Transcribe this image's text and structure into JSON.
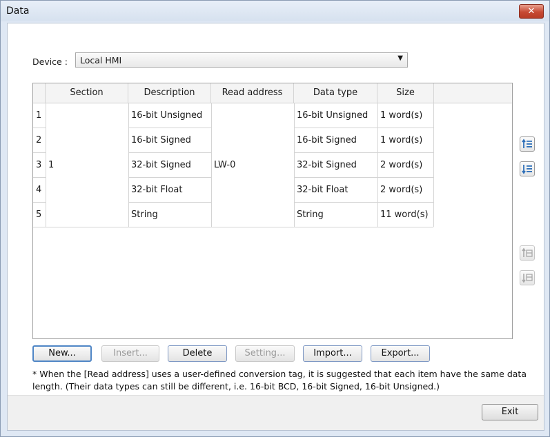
{
  "window": {
    "title": "Data",
    "close_glyph": "✕"
  },
  "device": {
    "label": "Device :",
    "value": "Local HMI"
  },
  "table": {
    "columns": [
      "",
      "Section",
      "Description",
      "Read address",
      "Data type",
      "Size"
    ],
    "section": "1",
    "read_address": "LW-0",
    "rows": [
      {
        "no": "1",
        "description": "16-bit Unsigned",
        "data_type": "16-bit Unsigned",
        "size": "1 word(s)"
      },
      {
        "no": "2",
        "description": "16-bit Signed",
        "data_type": "16-bit Signed",
        "size": "1 word(s)"
      },
      {
        "no": "3",
        "description": "32-bit Signed",
        "data_type": "32-bit Signed",
        "size": "2 word(s)"
      },
      {
        "no": "4",
        "description": "32-bit Float",
        "data_type": "32-bit Float",
        "size": "2 word(s)"
      },
      {
        "no": "5",
        "description": "String",
        "data_type": "String",
        "size": "11 word(s)"
      }
    ]
  },
  "buttons": {
    "new": "New...",
    "insert": "Insert...",
    "delete": "Delete",
    "setting": "Setting...",
    "import": "Import...",
    "export": "Export...",
    "exit": "Exit"
  },
  "side_icons": [
    "move-up-icon",
    "move-down-icon",
    "section-up-icon",
    "section-down-icon"
  ],
  "note": "* When the [Read address] uses a user-defined conversion tag, it is suggested that each item have the same data length. (Their data types can still be different, i.e. 16-bit BCD, 16-bit Signed, 16-bit Unsigned.)",
  "colors": {
    "close": "#c74a34",
    "icon_blue": "#2e6fb8",
    "default_border": "#4f86c6"
  }
}
